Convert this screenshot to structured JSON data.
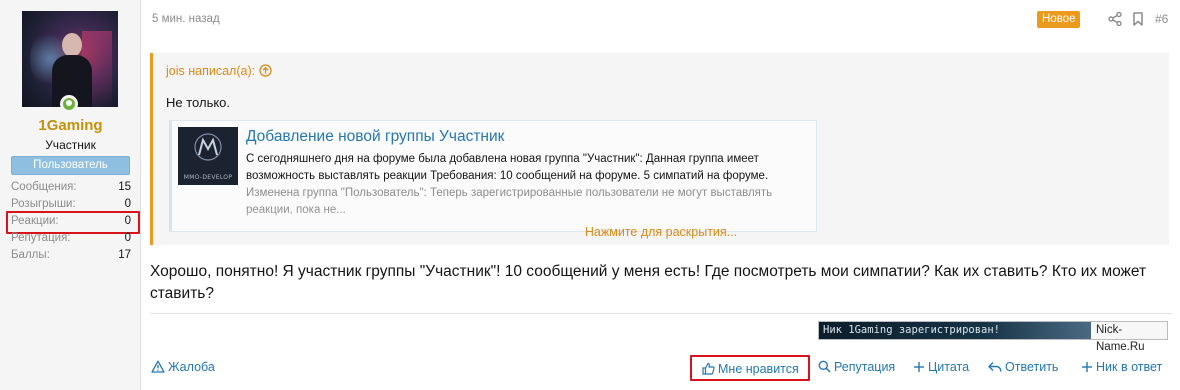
{
  "user": {
    "name": "1Gaming",
    "title": "Участник",
    "banner": "Пользователь",
    "stats": [
      {
        "label": "Сообщения:",
        "value": "15"
      },
      {
        "label": "Розыгрыши:",
        "value": "0"
      },
      {
        "label": "Реакции:",
        "value": "0"
      },
      {
        "label": "Репутация:",
        "value": "0"
      },
      {
        "label": "Баллы:",
        "value": "17"
      }
    ]
  },
  "post": {
    "time": "5 мин. назад",
    "badge": "Новое",
    "number": "#6",
    "quote": {
      "author": "jois написал(а):",
      "text": "Не только.",
      "unfurl": {
        "image_caption": "MMO-DEVELOP",
        "title": "Добавление новой группы Участник",
        "line1": "С сегодняшнего дня на форуме была добавлена новая группа \"Участник\": Данная группа имеет",
        "line2": "возможность выставлять реакции Требования: 10 сообщений на форуме. 5 симпатий на форуме.",
        "line3": "Изменена группа \"Пользователь\": Теперь зарегистрированные пользователи не могут выставлять",
        "line4": "реакции, пока не..."
      },
      "expand": "Нажмите для раскрытия..."
    },
    "body": "Хорошо, понятно! Я участник группы \"Участник\"! 10 сообщений у меня есть! Где посмотреть мои симпатии? Как их ставить? Кто их может ставить?",
    "signature": {
      "banner_text": "Ник 1Gaming зарегистрирован!",
      "site": "Nick-Name.Ru"
    },
    "actions": {
      "report": "Жалоба",
      "like": "Мне нравится",
      "reputation": "Репутация",
      "quote": "Цитата",
      "reply": "Ответить",
      "nick_reply": "Ник в ответ"
    }
  },
  "colors": {
    "accent": "#2577b1",
    "username": "#c4930c",
    "new_badge": "#ec9a1e",
    "highlight_box": "#d9131a"
  }
}
